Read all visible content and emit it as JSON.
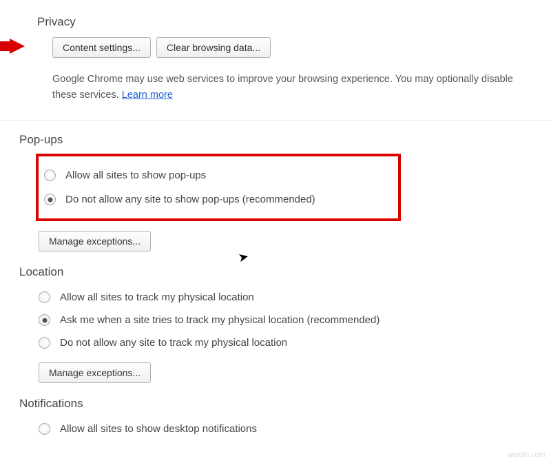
{
  "privacy": {
    "title": "Privacy",
    "content_settings_btn": "Content settings...",
    "clear_data_btn": "Clear browsing data...",
    "description_part1": "Google Chrome may use web services to improve your browsing experience. You may optionally disable these services. ",
    "learn_more": "Learn more"
  },
  "popups": {
    "title": "Pop-ups",
    "option_allow": "Allow all sites to show pop-ups",
    "option_block": "Do not allow any site to show pop-ups (recommended)",
    "manage_btn": "Manage exceptions..."
  },
  "location": {
    "title": "Location",
    "option_allow": "Allow all sites to track my physical location",
    "option_ask": "Ask me when a site tries to track my physical location (recommended)",
    "option_block": "Do not allow any site to track my physical location",
    "manage_btn": "Manage exceptions..."
  },
  "notifications": {
    "title": "Notifications",
    "option_allow": "Allow all sites to show desktop notifications"
  },
  "watermark": "wsxdn.com"
}
